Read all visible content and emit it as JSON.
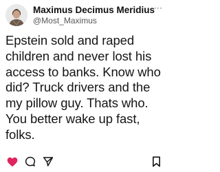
{
  "author": {
    "display_name": "Maximus Decimus Meridius",
    "handle": "@Most_Maximus",
    "avatar_icon": "profile-avatar"
  },
  "post": {
    "text": "Epstein sold and raped children and never lost his access to banks. Know who did? Truck drivers and the my pillow guy. Thats who. You better wake up fast, folks."
  },
  "menu": {
    "more_glyph": "···",
    "icon": "more-icon"
  },
  "actions": {
    "like": {
      "icon": "heart-icon",
      "color": "#e0245e",
      "liked": true
    },
    "reply": {
      "icon": "speech-bubble-icon"
    },
    "share": {
      "icon": "paper-plane-icon"
    },
    "bookmark": {
      "icon": "bookmark-icon"
    }
  },
  "colors": {
    "like_active": "#e0245e",
    "text": "#151515",
    "secondary_text": "#555555"
  }
}
